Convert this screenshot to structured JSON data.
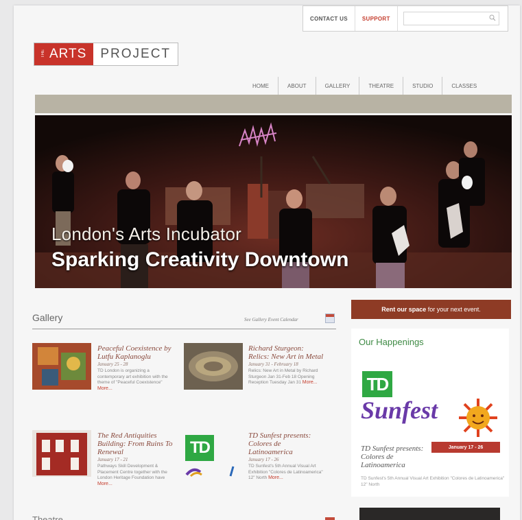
{
  "utility": {
    "contact_label": "CONTACT US",
    "support_label": "SUPPORT",
    "search_placeholder": ""
  },
  "logo": {
    "small": "THE",
    "part1": "ARTS",
    "part2": "PROJECT"
  },
  "nav": {
    "items": [
      {
        "label": "HOME"
      },
      {
        "label": "ABOUT"
      },
      {
        "label": "GALLERY"
      },
      {
        "label": "THEATRE"
      },
      {
        "label": "STUDIO"
      },
      {
        "label": "CLASSES"
      }
    ]
  },
  "hero": {
    "line1": "London's Arts Incubator",
    "line2": "Sparking Creativity Downtown",
    "sign_text": "ANIMAL"
  },
  "gallery": {
    "title": "Gallery",
    "calendar_link": "See Gallery Event Calendar",
    "cards": [
      {
        "title": "Peaceful Coexistence by Lutfu Kaplanoglu",
        "date": "January 25 - 28",
        "body": "TD London is organizing a contemporary art exhibition with the theme of \"Peaceful Coexistence\"",
        "more": "More..."
      },
      {
        "title": "Richard Sturgeon: Relics: New Art in Metal",
        "date": "January 31 - February 18",
        "body": "Relics: New Art in Metal by Richard Sturgeon Jan 31-Feb 18 Opening Reception Tuesday Jan 31",
        "more": "More..."
      },
      {
        "title": "The Red Antiquities Building: From Ruins To Renewal",
        "date": "January 17 - 21",
        "body": "Pathways Skill Development & Placement Centre together with the London Heritage Foundation have",
        "more": "More..."
      },
      {
        "title": "TD Sunfest presents: Colores de Latinoamerica",
        "date": "January 17 - 26",
        "body": "TD Sunfest's 5th Annual Visual Art Exhibition \"Colores de Latinoamerica\" 12\" North",
        "more": "More..."
      }
    ]
  },
  "sidebar": {
    "rent_bold": "Rent our space",
    "rent_rest": " for your next event.",
    "happenings_title": "Our Happenings",
    "td_logo": "TD",
    "sunfest_word": "Sunfest",
    "date_badge": "January 17 - 26",
    "event_title": "TD Sunfest presents: Colores de Latinoamerica",
    "event_body": "TD Sunfest's 5th Annual Visual Art Exhibition \"Colores de Latinoamerica\" 12\" North"
  },
  "theatre": {
    "title": "Theatre"
  },
  "colors": {
    "brand_red": "#c8332a",
    "rent_brown": "#8e3b25",
    "td_green": "#2fa843",
    "happenings_green": "#3e8a44",
    "nav_band": "#b8b3a4"
  }
}
